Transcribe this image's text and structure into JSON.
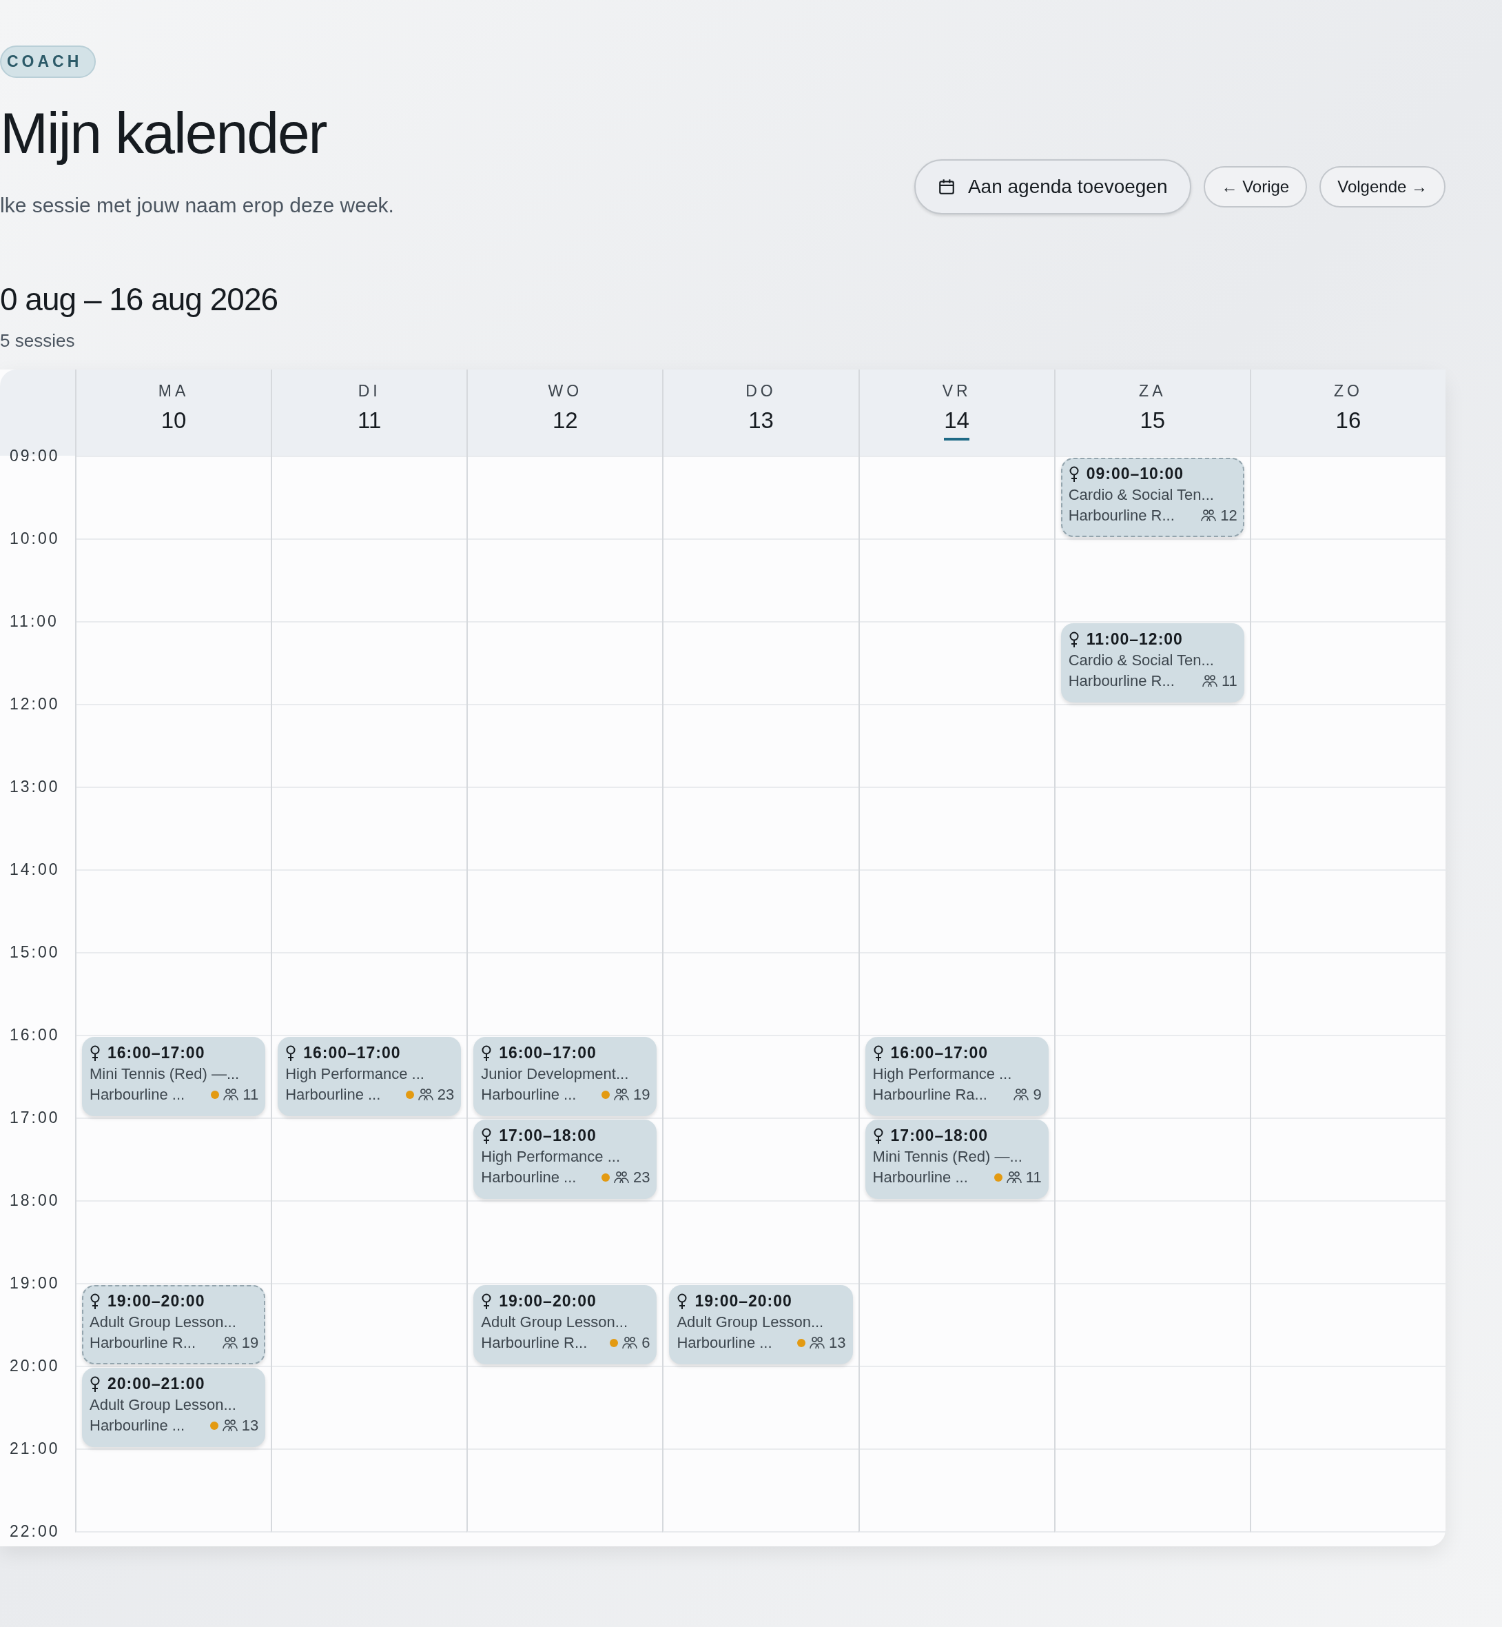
{
  "role_badge": "COACH",
  "title": "Mijn kalender",
  "subtitle": "lke sessie met jouw naam erop deze week.",
  "actions": [
    {
      "kind": "calendar",
      "label": "Aan agenda toevoegen"
    },
    {
      "kind": "plain",
      "label": "← Vorige"
    },
    {
      "kind": "plain",
      "label": "Volgende →"
    }
  ],
  "range": "0 aug – 16 aug 2026",
  "count": "5 sessies",
  "hours": [
    "09:00",
    "10:00",
    "11:00",
    "12:00",
    "13:00",
    "14:00",
    "15:00",
    "16:00",
    "17:00",
    "18:00",
    "19:00",
    "20:00",
    "21:00",
    "22:00"
  ],
  "days": [
    {
      "weekday": "MA",
      "date": "10",
      "selected": false,
      "events": [
        {
          "time": "16:00–17:00",
          "title": "Mini Tennis (Red) —...",
          "location": "Harbourline ...",
          "status_dot": true,
          "dashed": false,
          "attendees": "11"
        },
        {
          "time": "19:00–20:00",
          "title": "Adult Group Lesson...",
          "location": "Harbourline R...",
          "status_dot": false,
          "dashed": true,
          "attendees": "19"
        },
        {
          "time": "20:00–21:00",
          "title": "Adult Group Lesson...",
          "location": "Harbourline ...",
          "status_dot": true,
          "dashed": false,
          "attendees": "13"
        }
      ]
    },
    {
      "weekday": "DI",
      "date": "11",
      "selected": false,
      "events": [
        {
          "time": "16:00–17:00",
          "title": "High Performance ...",
          "location": "Harbourline ...",
          "status_dot": true,
          "dashed": false,
          "attendees": "23"
        }
      ]
    },
    {
      "weekday": "WO",
      "date": "12",
      "selected": false,
      "events": [
        {
          "time": "16:00–17:00",
          "title": "Junior Development...",
          "location": "Harbourline ...",
          "status_dot": true,
          "dashed": false,
          "attendees": "19"
        },
        {
          "time": "17:00–18:00",
          "title": "High Performance ...",
          "location": "Harbourline ...",
          "status_dot": true,
          "dashed": false,
          "attendees": "23"
        },
        {
          "time": "19:00–20:00",
          "title": "Adult Group Lesson...",
          "location": "Harbourline R...",
          "status_dot": true,
          "dashed": false,
          "attendees": "6"
        }
      ]
    },
    {
      "weekday": "DO",
      "date": "13",
      "selected": false,
      "events": [
        {
          "time": "19:00–20:00",
          "title": "Adult Group Lesson...",
          "location": "Harbourline ...",
          "status_dot": true,
          "dashed": false,
          "attendees": "13"
        }
      ]
    },
    {
      "weekday": "VR",
      "date": "14",
      "selected": true,
      "events": [
        {
          "time": "16:00–17:00",
          "title": "High Performance ...",
          "location": "Harbourline Ra...",
          "status_dot": false,
          "dashed": false,
          "attendees": "9"
        },
        {
          "time": "17:00–18:00",
          "title": "Mini Tennis (Red) —...",
          "location": "Harbourline ...",
          "status_dot": true,
          "dashed": false,
          "attendees": "11"
        }
      ]
    },
    {
      "weekday": "ZA",
      "date": "15",
      "selected": false,
      "events": [
        {
          "time": "09:00–10:00",
          "title": "Cardio & Social Ten...",
          "location": "Harbourline R...",
          "status_dot": false,
          "dashed": true,
          "attendees": "12"
        },
        {
          "time": "11:00–12:00",
          "title": "Cardio & Social Ten...",
          "location": "Harbourline R...",
          "status_dot": false,
          "dashed": false,
          "attendees": "11"
        }
      ]
    },
    {
      "weekday": "ZO",
      "date": "16",
      "selected": false
    }
  ]
}
